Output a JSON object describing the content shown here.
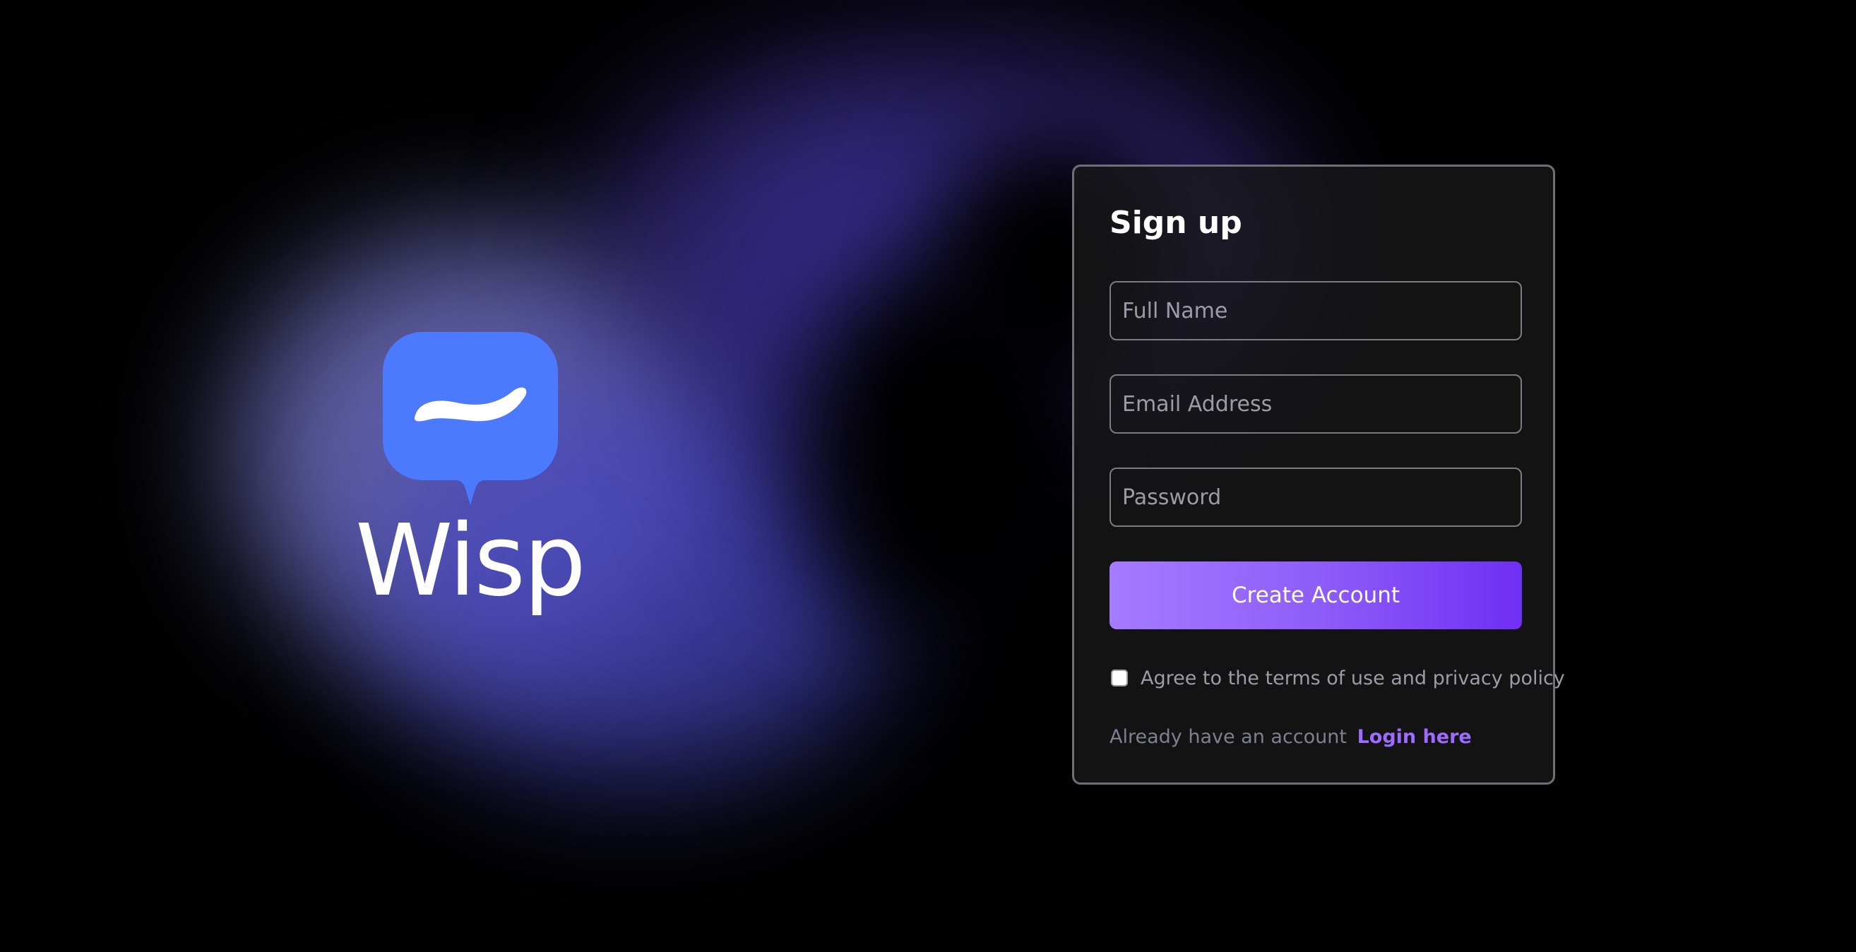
{
  "brand": {
    "name": "Wisp",
    "logo_icon": "chat-bubble-wave-icon",
    "logo_color": "#4c7aff"
  },
  "signup": {
    "title": "Sign up",
    "fields": {
      "full_name_placeholder": "Full Name",
      "email_placeholder": "Email Address",
      "password_placeholder": "Password"
    },
    "submit_label": "Create Account",
    "submit_gradient": [
      "#a57bff",
      "#6f2ff3"
    ],
    "terms_label": "Agree to the terms of use and privacy policy",
    "terms_checked": false,
    "login_prompt": "Already have an account",
    "login_link": "Login here",
    "link_color": "#9d6cff"
  }
}
